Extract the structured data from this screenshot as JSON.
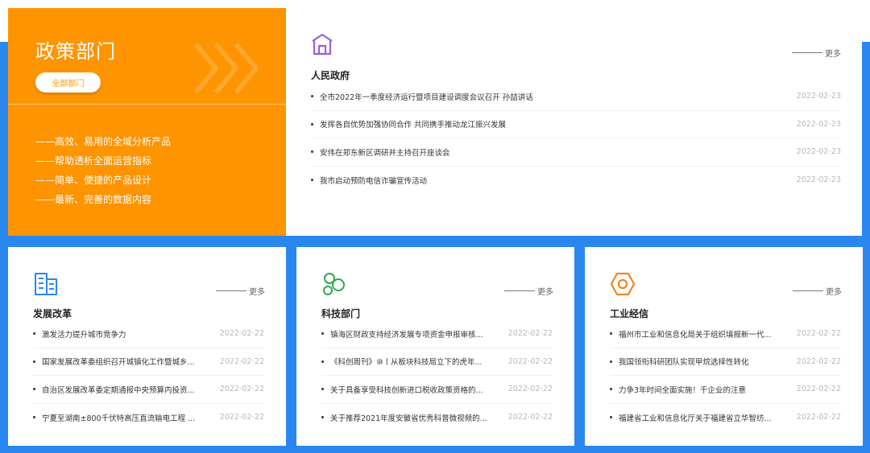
{
  "policy": {
    "title": "政策部门",
    "all_button": "全部部门",
    "features": [
      "——高效、易用的全域分析产品",
      "——帮助透析全面运营指标",
      "——简单、便捷的产品设计",
      "——最新、完善的数据内容"
    ]
  },
  "colors": {
    "accent_orange": "#fe9400",
    "background_blue": "#2a87f0",
    "icon_purple": "#9b5fe0",
    "icon_blue": "#2a87f0",
    "icon_green": "#2fa84f",
    "icon_orange": "#f0841e"
  },
  "more_label": "更多",
  "main": {
    "icon": "house-icon",
    "title": "人民政府",
    "items": [
      {
        "text": "全市2022年一季度经济运行暨项目建设调度会议召开 孙喆讲话",
        "date": "2022-02-23"
      },
      {
        "text": "发挥各自优势加强协同合作 共同携手推动龙江振兴发展",
        "date": "2022-02-23"
      },
      {
        "text": "安伟在郑东新区调研并主持召开座谈会",
        "date": "2022-02-23"
      },
      {
        "text": "我市启动预防电信诈骗宣传活动",
        "date": "2022-02-23"
      }
    ]
  },
  "cards": [
    {
      "icon": "building-icon",
      "title": "发展改革",
      "items": [
        {
          "text": "激发活力提升城市竞争力",
          "date": "2022-02-22"
        },
        {
          "text": "国家发展改革委组织召开城镇化工作暨城乡...",
          "date": "2022-02-22"
        },
        {
          "text": "自治区发展改革委定期通报中央预算内投资...",
          "date": "2022-02-22"
        },
        {
          "text": "宁夏至湖南±800千伏特高压直流输电工程 ...",
          "date": "2022-02-22"
        }
      ]
    },
    {
      "icon": "molecule-icon",
      "title": "科技部门",
      "items": [
        {
          "text": "镇海区财政支持经济发展专项资金申报审核...",
          "date": "2022-02-22"
        },
        {
          "text": "《科创周刊》⑩丨从板块科技局立下的虎年...",
          "date": "2022-02-22"
        },
        {
          "text": "关于具备享受科技创新进口税收政策资格的...",
          "date": "2022-02-22"
        },
        {
          "text": "关于推荐2021年度安徽省优秀科普微视频的...",
          "date": "2022-02-22"
        }
      ]
    },
    {
      "icon": "hex-nut-icon",
      "title": "工业经信",
      "items": [
        {
          "text": "福州市工业和信息化局关于组织填报新一代...",
          "date": "2022-02-22"
        },
        {
          "text": "我国领衔科研团队实现甲烷选择性转化",
          "date": "2022-02-22"
        },
        {
          "text": "力争3年时间全面实施！千企业的注意",
          "date": "2022-02-22"
        },
        {
          "text": "福建省工业和信息化厅关于福建省立华智纺...",
          "date": "2022-02-22"
        }
      ]
    }
  ]
}
